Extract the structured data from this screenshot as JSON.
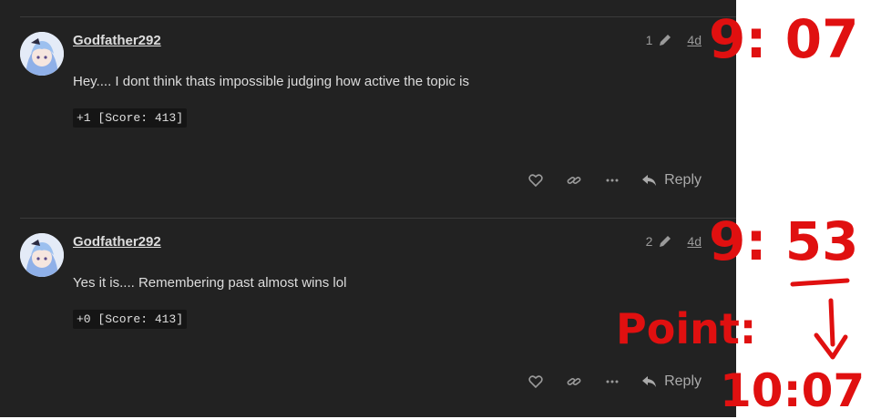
{
  "posts": [
    {
      "username": "Godfather292",
      "edit_count": "1",
      "date": "4d",
      "body": "Hey.... I dont think thats impossible judging how active the topic is",
      "score": "+1 [Score: 413]",
      "reply_label": "Reply"
    },
    {
      "username": "Godfather292",
      "edit_count": "2",
      "date": "4d",
      "body": "Yes it is.... Remembering past almost wins lol",
      "score": "+0 [Score: 413]",
      "reply_label": "Reply"
    }
  ],
  "annotations": {
    "time1": "9: 07",
    "time2": "9: 53",
    "point_label": "Point:",
    "time3": "10:07"
  },
  "colors": {
    "background": "#222222",
    "annotation": "#e01010"
  },
  "icons": [
    "pencil-icon",
    "heart-icon",
    "link-icon",
    "more-icon",
    "reply-icon"
  ]
}
